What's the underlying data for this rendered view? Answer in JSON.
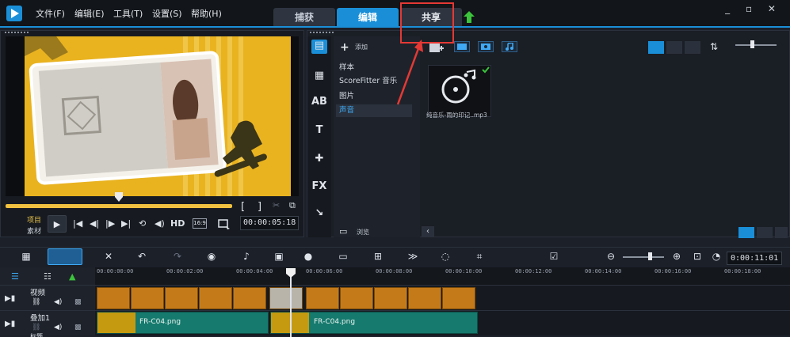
{
  "menu": {
    "file": "文件(F)",
    "edit": "编辑(E)",
    "tools": "工具(T)",
    "settings": "设置(S)",
    "help": "帮助(H)"
  },
  "tabs": {
    "capture": "捕获",
    "edit": "编辑",
    "share": "共享"
  },
  "window_controls": "_ ▫ ✕",
  "preview": {
    "project_label": "项目",
    "clip_label": "素材",
    "hd": "HD",
    "aspect": "16:9",
    "timecode": "00:00:05:18"
  },
  "library": {
    "add_label": "添加",
    "folders": [
      "样本",
      "ScoreFitter 音乐",
      "图片",
      "声音"
    ],
    "selected_folder": "声音",
    "browse_label": "浏览",
    "thumb_name": "纯音乐-雨的印记..mp3"
  },
  "timeline": {
    "timecode": "0:00:11:01",
    "ruler_ticks": [
      "00:00:00:00",
      "00:00:02:00",
      "00:00:04:00",
      "00:00:06:00",
      "00:00:08:00",
      "00:00:10:00",
      "00:00:12:00",
      "00:00:14:00",
      "00:00:16:00",
      "00:00:18:00"
    ],
    "tracks": {
      "video": "视频",
      "overlay": "叠加1",
      "title": "标题"
    },
    "overlay_clips": [
      "FR-C04.png",
      "FR-C04.png"
    ]
  },
  "colors": {
    "accent": "#1a8fd8",
    "annotation": "#e53935",
    "clip_video": "#c57a1a",
    "clip_overlay": "#167a6e"
  }
}
